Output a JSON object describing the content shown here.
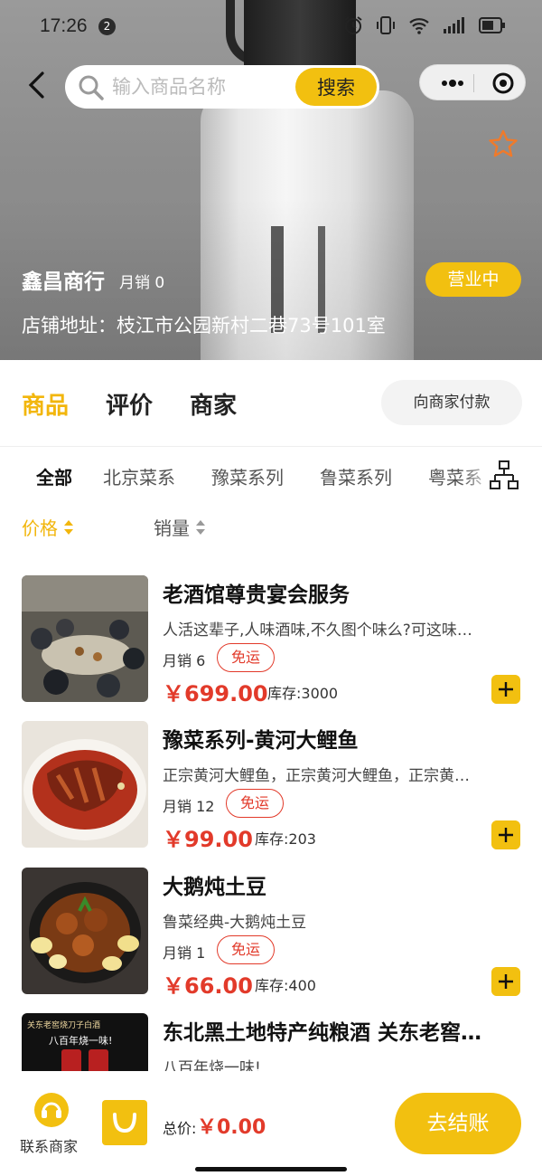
{
  "status_bar": {
    "time": "17:26",
    "notification_count": "2"
  },
  "header": {
    "search_placeholder": "输入商品名称",
    "search_button": "搜索"
  },
  "shop": {
    "name": "鑫昌商行",
    "monthly_sales": "月销 0",
    "status": "营业中",
    "address": "店铺地址：枝江市公园新村二巷73号101室"
  },
  "main_tabs": [
    "商品",
    "评价",
    "商家"
  ],
  "pay_merchant": "向商家付款",
  "categories": [
    "全部",
    "北京菜系",
    "豫菜系列",
    "鲁菜系列",
    "粤菜系"
  ],
  "sort": {
    "price": "价格",
    "sales": "销量"
  },
  "products": [
    {
      "name": "老酒馆尊贵宴会服务",
      "desc": "人活这辈子,人味酒味,不久图个味么?可这味…",
      "sales": "月销 6",
      "tag": "免运",
      "price": "￥699.00",
      "stock": "库存:3000"
    },
    {
      "name": "豫菜系列-黄河大鲤鱼",
      "desc": "正宗黄河大鲤鱼，正宗黄河大鲤鱼，正宗黄…",
      "sales": "月销 12",
      "tag": "免运",
      "price": "￥99.00",
      "stock": "库存:203"
    },
    {
      "name": "大鹅炖土豆",
      "desc": "鲁菜经典-大鹅炖土豆",
      "sales": "月销 1",
      "tag": "免运",
      "price": "￥66.00",
      "stock": "库存:400"
    },
    {
      "name": "东北黑土地特产纯粮酒 关东老窖…",
      "desc": "八百年烧一味!",
      "image_text_1": "关东老窖烧刀子白酒",
      "image_text_2": "八百年烧一味!"
    }
  ],
  "bottom": {
    "contact": "联系商家",
    "total_label": "总价:",
    "total_value": "￥0.00",
    "checkout": "去结账"
  },
  "colors": {
    "accent": "#f2c010",
    "price": "#e23a2a"
  }
}
